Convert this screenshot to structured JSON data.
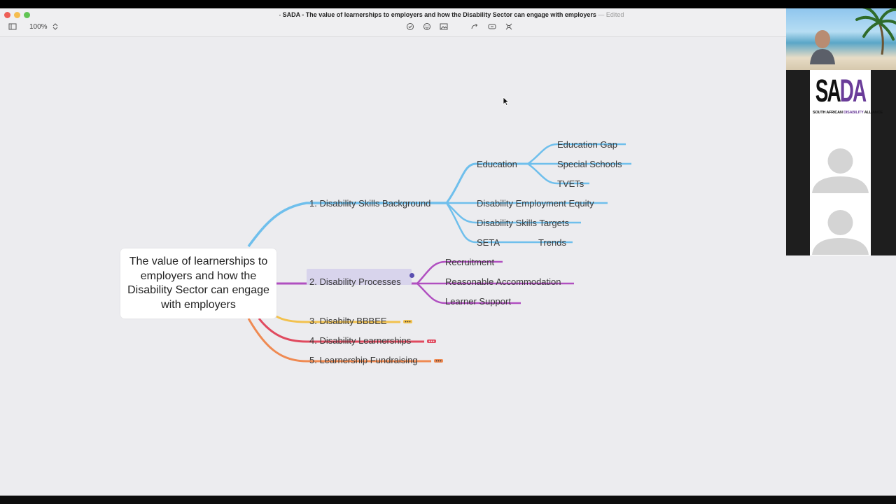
{
  "window": {
    "title": "SADA - The value of learnerships to employers and how the Disability Sector can engage with employers",
    "status": "Edited"
  },
  "toolbar": {
    "zoom": "100%",
    "icons": [
      "sidebar-icon",
      "zoom-stepper-icon",
      "task-icon",
      "emoji-icon",
      "image-icon",
      "relationship-icon",
      "boundary-icon",
      "summary-icon"
    ]
  },
  "mindmap": {
    "central_topic": "The value of learnerships to employers and how the Disability Sector can engage with employers",
    "branches": [
      {
        "label": "1. Disability Skills Background",
        "color": "#6fbfec",
        "children": [
          {
            "label": "Education",
            "children": [
              "Education Gap",
              "Special Schools",
              "TVETs"
            ]
          },
          {
            "label": "Disability Employment Equity"
          },
          {
            "label": "Disability Skills Targets"
          },
          {
            "label": "SETA",
            "extra": "Trends"
          }
        ]
      },
      {
        "label": "2. Disability Processes",
        "color": "#b04fc0",
        "selected": true,
        "children": [
          "Recruitment",
          "Reasonable Accommodation",
          "Learner Support"
        ]
      },
      {
        "label": "3. Disabilty BBBEE",
        "color": "#f2c14e",
        "collapsed": true
      },
      {
        "label": "4. Disability Learnerships",
        "color": "#e04a5f",
        "collapsed": true
      },
      {
        "label": "5. Learnership Fundraising",
        "color": "#ef8a52",
        "collapsed": true
      }
    ]
  },
  "video_panel": {
    "logo_text": "SADA",
    "logo_sub": "SOUTH AFRICAN DISABILITY ALLIANCE",
    "participants": [
      "participant",
      "participant"
    ]
  },
  "colors": {
    "canvas": "#ececef",
    "accent_purple": "#6a3c99"
  }
}
